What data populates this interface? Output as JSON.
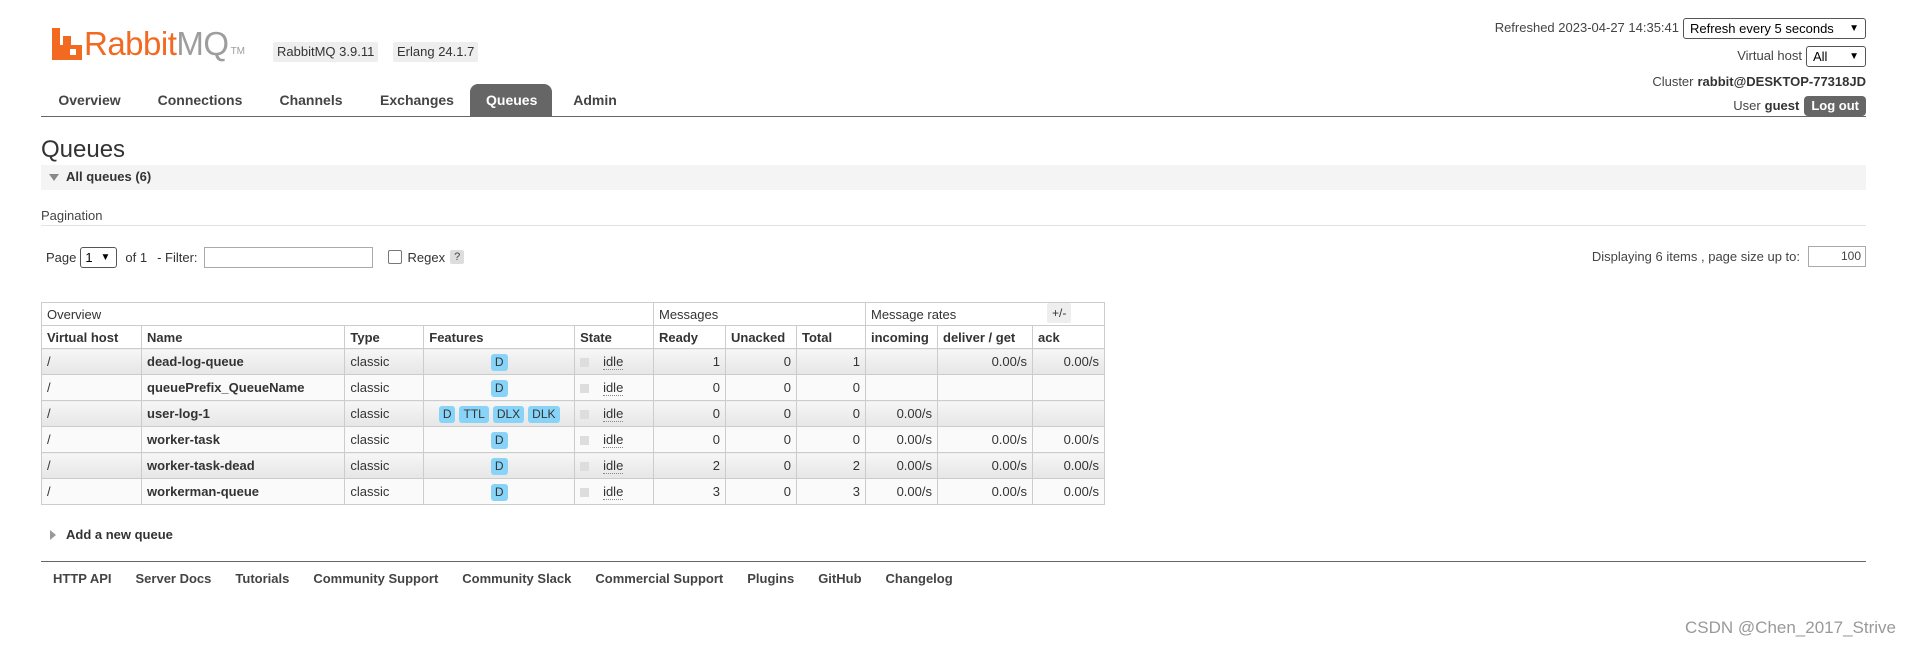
{
  "logo": {
    "brand_primary": "Rabbit",
    "brand_secondary": "MQ",
    "trademark": "TM",
    "color": "#f26a22"
  },
  "versions": {
    "rabbitmq": "RabbitMQ 3.9.11",
    "erlang": "Erlang 24.1.7"
  },
  "header": {
    "refreshed_label": "Refreshed 2023-04-27 14:35:41",
    "refresh_select": "Refresh every 5 seconds",
    "vhost_label": "Virtual host",
    "vhost_select": "All",
    "cluster_label": "Cluster",
    "cluster_name": "rabbit@DESKTOP-77318JD",
    "user_label": "User",
    "user_name": "guest",
    "logout_label": "Log out"
  },
  "tabs": [
    {
      "label": "Overview",
      "active": false
    },
    {
      "label": "Connections",
      "active": false
    },
    {
      "label": "Channels",
      "active": false
    },
    {
      "label": "Exchanges",
      "active": false
    },
    {
      "label": "Queues",
      "active": true
    },
    {
      "label": "Admin",
      "active": false
    }
  ],
  "page": {
    "title": "Queues",
    "all_queues_label": "All queues (6)",
    "pagination_label": "Pagination",
    "page_label": "Page",
    "page_select": "1",
    "of_label": "of 1",
    "filter_label": "- Filter:",
    "regex_label": "Regex",
    "regex_help": "?",
    "display_label": "Displaying 6 items , page size up to:",
    "page_size": "100",
    "plus_minus": "+/-",
    "add_queue_label": "Add a new queue"
  },
  "table": {
    "group_headers": [
      "Overview",
      "Messages",
      "Message rates"
    ],
    "columns": [
      "Virtual host",
      "Name",
      "Type",
      "Features",
      "State",
      "Ready",
      "Unacked",
      "Total",
      "incoming",
      "deliver / get",
      "ack"
    ],
    "rows": [
      {
        "vhost": "/",
        "name": "dead-log-queue",
        "type": "classic",
        "features": [
          "D"
        ],
        "state": "idle",
        "ready": "1",
        "unacked": "0",
        "total": "1",
        "incoming": "",
        "deliver": "0.00/s",
        "ack": "0.00/s"
      },
      {
        "vhost": "/",
        "name": "queuePrefix_QueueName",
        "type": "classic",
        "features": [
          "D"
        ],
        "state": "idle",
        "ready": "0",
        "unacked": "0",
        "total": "0",
        "incoming": "",
        "deliver": "",
        "ack": ""
      },
      {
        "vhost": "/",
        "name": "user-log-1",
        "type": "classic",
        "features": [
          "D",
          "TTL",
          "DLX",
          "DLK"
        ],
        "state": "idle",
        "ready": "0",
        "unacked": "0",
        "total": "0",
        "incoming": "0.00/s",
        "deliver": "",
        "ack": ""
      },
      {
        "vhost": "/",
        "name": "worker-task",
        "type": "classic",
        "features": [
          "D"
        ],
        "state": "idle",
        "ready": "0",
        "unacked": "0",
        "total": "0",
        "incoming": "0.00/s",
        "deliver": "0.00/s",
        "ack": "0.00/s"
      },
      {
        "vhost": "/",
        "name": "worker-task-dead",
        "type": "classic",
        "features": [
          "D"
        ],
        "state": "idle",
        "ready": "2",
        "unacked": "0",
        "total": "2",
        "incoming": "0.00/s",
        "deliver": "0.00/s",
        "ack": "0.00/s"
      },
      {
        "vhost": "/",
        "name": "workerman-queue",
        "type": "classic",
        "features": [
          "D"
        ],
        "state": "idle",
        "ready": "3",
        "unacked": "0",
        "total": "3",
        "incoming": "0.00/s",
        "deliver": "0.00/s",
        "ack": "0.00/s"
      }
    ]
  },
  "footer": {
    "links": [
      "HTTP API",
      "Server Docs",
      "Tutorials",
      "Community Support",
      "Community Slack",
      "Commercial Support",
      "Plugins",
      "GitHub",
      "Changelog"
    ]
  },
  "watermark": "CSDN @Chen_2017_Strive"
}
